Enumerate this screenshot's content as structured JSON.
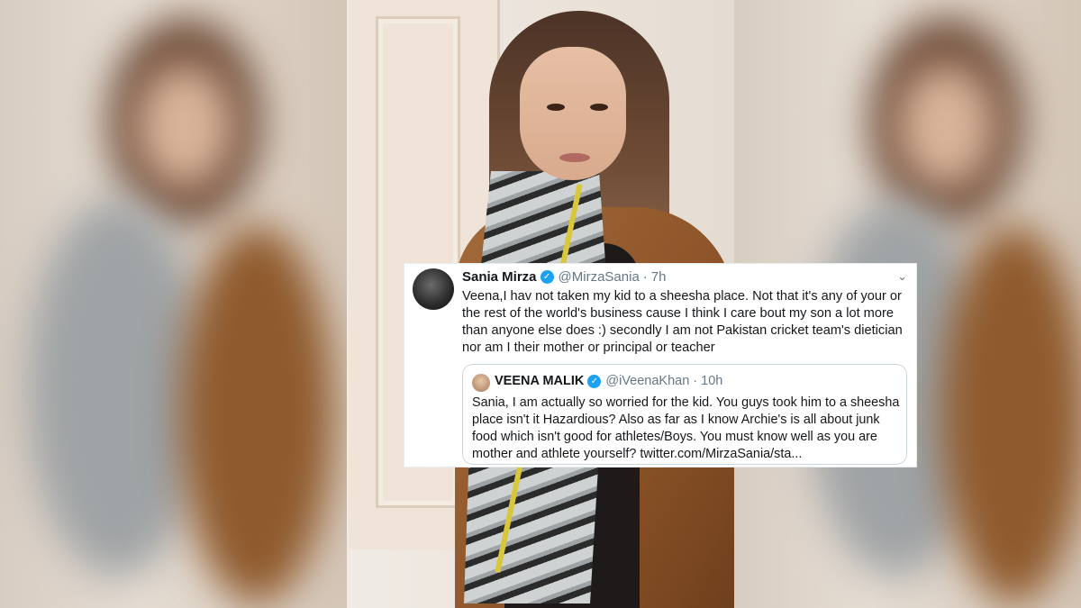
{
  "tweet": {
    "author_name": "Sania Mirza",
    "author_handle": "@MirzaSania",
    "separator": "·",
    "time": "7h",
    "menu_icon": "chevron-down-icon",
    "verified_icon": "verified-badge-icon",
    "text": "Veena,I hav not taken my kid to a sheesha place. Not that it's any of your or the rest of the world's business cause I think I care bout my son a lot more than anyone else does :) secondly I am not Pakistan cricket team's dietician nor am I their mother or principal or teacher"
  },
  "quoted_tweet": {
    "author_name": "VEENA MALIK",
    "author_handle": "@iVeenaKhan",
    "separator": "·",
    "time": "10h",
    "text": "Sania, I am actually so worried for the kid. You guys took him to a sheesha place isn't it Hazardious? Also as far as I know Archie's is all about junk food which isn't good for athletes/Boys. You must know well as you are mother and athlete yourself? twitter.com/MirzaSania/sta..."
  },
  "colors": {
    "accent": "#1da1f2",
    "secondary_text": "#657786",
    "border": "#ccd6dd"
  }
}
